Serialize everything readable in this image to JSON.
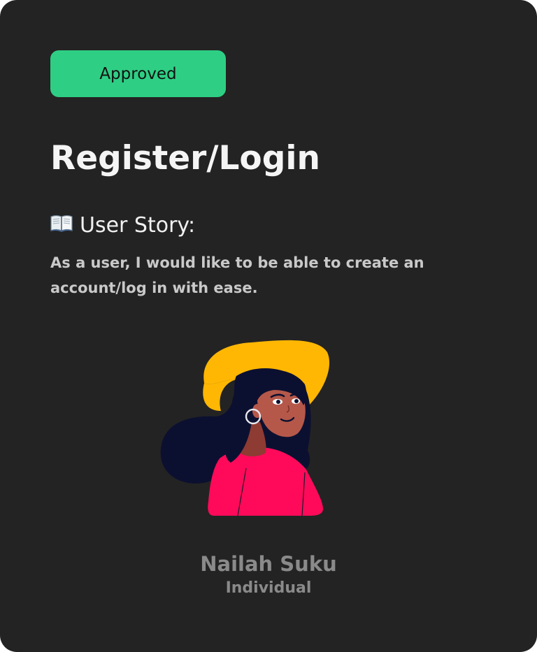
{
  "card": {
    "status_badge": "Approved",
    "title": "Register/Login",
    "story_heading": "User Story:",
    "story_text": "As a user, I would like to be able to create an account/log in with ease.",
    "person": {
      "name": "Nailah Suku",
      "role": "Individual"
    }
  },
  "colors": {
    "card_background": "#232323",
    "badge_background": "#2ecf84",
    "hat": "#ffb703",
    "shirt": "#ff0a5a",
    "hair": "#0c1030",
    "skin": "#b5584a"
  },
  "icons": {
    "story_heading_icon": "open-book-icon",
    "avatar": "woman-with-yellow-hat-illustration"
  }
}
